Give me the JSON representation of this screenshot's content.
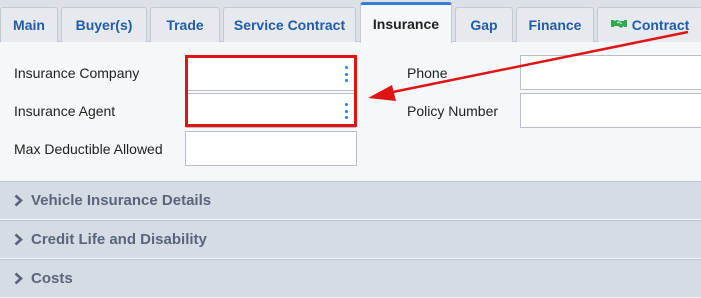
{
  "tabs": [
    {
      "label": "Main",
      "active": false
    },
    {
      "label": "Buyer(s)",
      "active": false
    },
    {
      "label": "Trade",
      "active": false
    },
    {
      "label": "Service Contract",
      "active": false
    },
    {
      "label": "Insurance",
      "active": true
    },
    {
      "label": "Gap",
      "active": false
    },
    {
      "label": "Finance",
      "active": false
    },
    {
      "label": "Contract",
      "active": false,
      "icon": "handshake-icon"
    }
  ],
  "form": {
    "insurance_company_label": "Insurance Company",
    "insurance_company_value": "",
    "insurance_agent_label": "Insurance Agent",
    "insurance_agent_value": "",
    "max_deductible_label": "Max Deductible Allowed",
    "max_deductible_value": "",
    "phone_label": "Phone",
    "phone_value": "",
    "policy_number_label": "Policy Number",
    "policy_number_value": ""
  },
  "sections": [
    {
      "label": "Vehicle Insurance Details",
      "icon": "chevron-right-icon"
    },
    {
      "label": "Credit Life and Disability",
      "icon": "chevron-right-icon"
    },
    {
      "label": "Costs",
      "icon": "chevron-right-icon"
    }
  ],
  "colors": {
    "accent": "#3a7bd5",
    "tab_text": "#1f5da8",
    "highlight": "#e01414",
    "section_text": "#5a6577",
    "contract_icon": "#2fa84f"
  }
}
